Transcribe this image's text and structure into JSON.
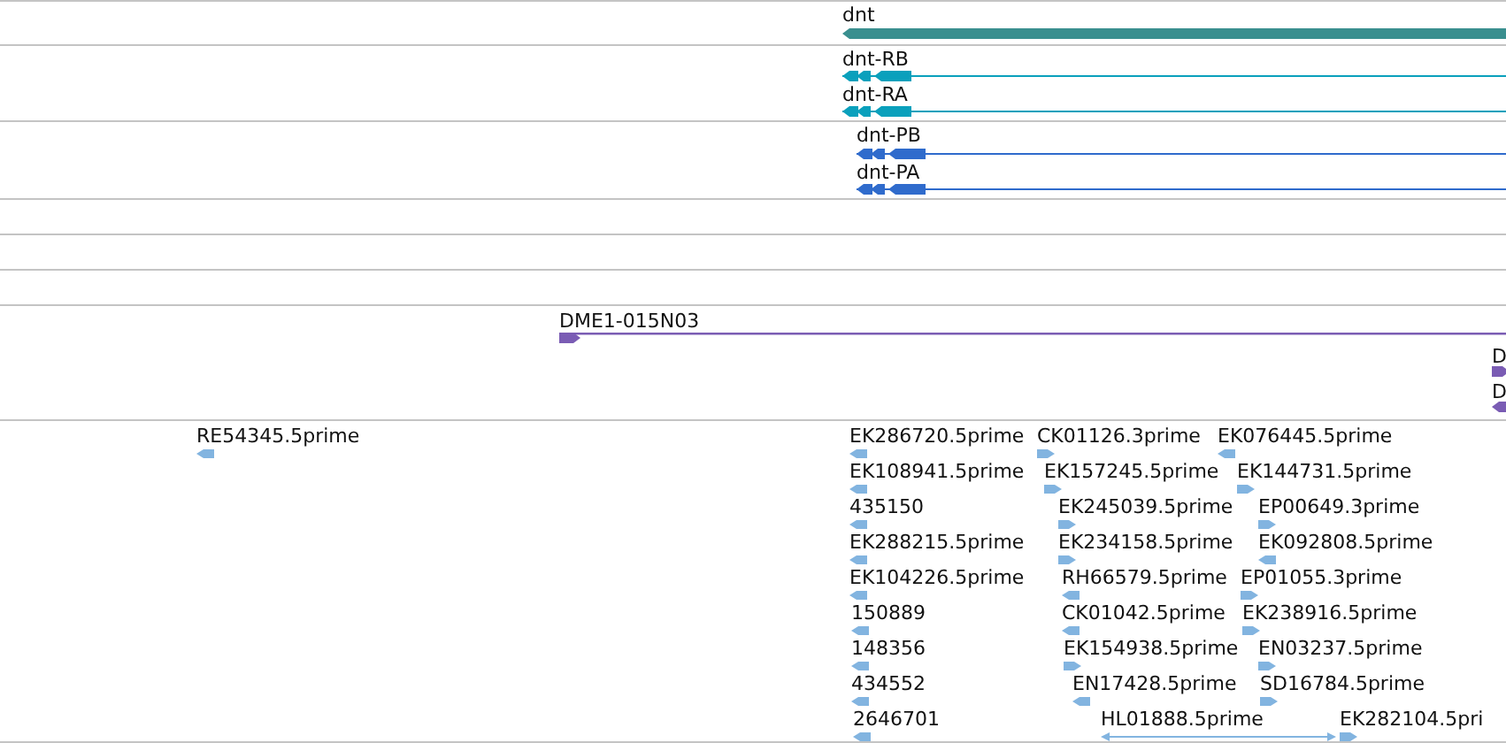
{
  "tracks": [
    {
      "kind": "gene",
      "color": "#3a8f8f",
      "features": [
        {
          "label": "dnt",
          "kind": "left"
        }
      ]
    },
    {
      "kind": "transcript",
      "color": "#0aa0bc",
      "features": [
        {
          "label": "dnt-RB",
          "kind": "left"
        },
        {
          "label": "dnt-RA",
          "kind": "left"
        }
      ]
    },
    {
      "kind": "transcript",
      "color": "#2f6bcc",
      "features": [
        {
          "label": "dnt-PB",
          "kind": "left"
        },
        {
          "label": "dnt-PA",
          "kind": "left"
        }
      ]
    },
    {
      "kind": "empty"
    },
    {
      "kind": "empty"
    },
    {
      "kind": "empty"
    },
    {
      "kind": "clone",
      "color": "#7a5cb4",
      "features": [
        {
          "label": "DME1-015N03",
          "kind": "right"
        },
        {
          "label": "D",
          "kind": "right"
        },
        {
          "label": "D",
          "kind": "left"
        }
      ]
    },
    {
      "kind": "est",
      "color": "#82b4e0",
      "features": [
        {
          "label": "RE54345.5prime",
          "kind": "left"
        },
        {
          "label": "EK286720.5prime",
          "kind": "left"
        },
        {
          "label": "CK01126.3prime",
          "kind": "right"
        },
        {
          "label": "EK076445.5prime",
          "kind": "left"
        },
        {
          "label": "EK108941.5prime",
          "kind": "left"
        },
        {
          "label": "EK157245.5prime",
          "kind": "right"
        },
        {
          "label": "EK144731.5prime",
          "kind": "right"
        },
        {
          "label": "435150",
          "kind": "left"
        },
        {
          "label": "EK245039.5prime",
          "kind": "right"
        },
        {
          "label": "EP00649.3prime",
          "kind": "right"
        },
        {
          "label": "EK288215.5prime",
          "kind": "left"
        },
        {
          "label": "EK234158.5prime",
          "kind": "right"
        },
        {
          "label": "EK092808.5prime",
          "kind": "left"
        },
        {
          "label": "EK104226.5prime",
          "kind": "left"
        },
        {
          "label": "RH66579.5prime",
          "kind": "left"
        },
        {
          "label": "EP01055.3prime",
          "kind": "right"
        },
        {
          "label": "150889",
          "kind": "left"
        },
        {
          "label": "CK01042.5prime",
          "kind": "left"
        },
        {
          "label": "EK238916.5prime",
          "kind": "right"
        },
        {
          "label": "148356",
          "kind": "left"
        },
        {
          "label": "EK154938.5prime",
          "kind": "right"
        },
        {
          "label": "EN03237.5prime",
          "kind": "right"
        },
        {
          "label": "434552",
          "kind": "left"
        },
        {
          "label": "EN17428.5prime",
          "kind": "left"
        },
        {
          "label": "SD16784.5prime",
          "kind": "right"
        },
        {
          "label": "2646701",
          "kind": "left"
        },
        {
          "label": "HL01888.5prime",
          "kind": "both"
        },
        {
          "label": "EK282104.5pri",
          "kind": "right"
        }
      ]
    }
  ]
}
